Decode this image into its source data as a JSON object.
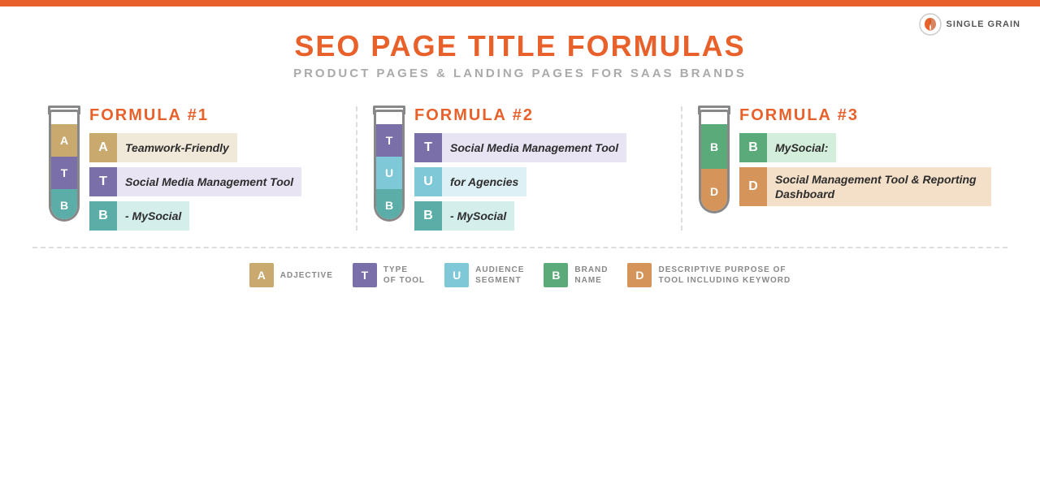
{
  "topBar": {},
  "logo": {
    "text": "SINGLE GRAIN"
  },
  "header": {
    "titleBlack1": "SEO PAGE TITLE ",
    "titleOrange": "FORMULAS",
    "subtitle": "PRODUCT PAGES & LANDING PAGES FOR SAAS BRANDS"
  },
  "formulas": [
    {
      "id": "formula1",
      "label": "FORMULA #1",
      "tubeSegments": [
        "A",
        "T",
        "B"
      ],
      "tubeColors": [
        "seg-tan",
        "seg-purple",
        "seg-teal"
      ],
      "rows": [
        {
          "letter": "A",
          "color": "seg-tan",
          "text": "Teamwork-Friendly"
        },
        {
          "letter": "T",
          "color": "seg-purple",
          "text": "Social Media Management Tool"
        },
        {
          "letter": "B",
          "color": "seg-teal",
          "text": "- MySocial"
        }
      ]
    },
    {
      "id": "formula2",
      "label": "FORMULA #2",
      "tubeSegments": [
        "T",
        "U",
        "B"
      ],
      "tubeColors": [
        "seg-purple",
        "seg-light-blue",
        "seg-teal"
      ],
      "rows": [
        {
          "letter": "T",
          "color": "seg-purple",
          "text": "Social Media Management Tool"
        },
        {
          "letter": "U",
          "color": "seg-light-blue",
          "text": "for Agencies"
        },
        {
          "letter": "B",
          "color": "seg-teal",
          "text": "- MySocial"
        }
      ]
    },
    {
      "id": "formula3",
      "label": "FORMULA #3",
      "tubeSegments": [
        "B",
        "D"
      ],
      "tubeColors": [
        "seg-green",
        "seg-orange"
      ],
      "rows": [
        {
          "letter": "B",
          "color": "seg-green",
          "text": "MySocial:"
        },
        {
          "letter": "D",
          "color": "seg-orange",
          "text": "Social Management Tool & Reporting Dashboard"
        }
      ]
    }
  ],
  "legend": [
    {
      "letter": "A",
      "color": "seg-tan",
      "text": "ADJECTIVE"
    },
    {
      "letter": "T",
      "color": "seg-purple",
      "text": "TYPE\nOF TOOL"
    },
    {
      "letter": "U",
      "color": "seg-light-blue",
      "text": "AUDIENCE\nSEGMENT"
    },
    {
      "letter": "B",
      "color": "seg-green",
      "text": "BRAND\nNAME"
    },
    {
      "letter": "D",
      "color": "seg-orange",
      "text": "DESCRIPTIVE PURPOSE OF\nTOOL INCLUDING KEYWORD"
    }
  ]
}
